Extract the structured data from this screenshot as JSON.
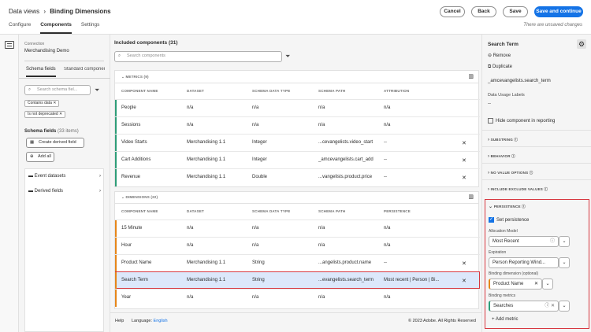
{
  "header": {
    "crumb_root": "Data views",
    "crumb_sep": "›",
    "crumb_current": "Binding Dimensions",
    "tabs": [
      "Configure",
      "Components",
      "Settings"
    ],
    "buttons": {
      "cancel": "Cancel",
      "back": "Back",
      "save": "Save",
      "save_continue": "Save and continue"
    },
    "unsaved": "There are unsaved changes"
  },
  "left": {
    "connection_label": "Connection",
    "connection_value": "Merchandising Demo",
    "tabs": [
      "Schema fields",
      "Standard componen"
    ],
    "search_placeholder": "Search schema fiel...",
    "filters": [
      "Contains data",
      "Is not deprecated"
    ],
    "count_label": "Schema fields",
    "count_value": "(33 items)",
    "create_btn": "Create derived field",
    "add_all": "Add all",
    "folders": [
      "Event datasets",
      "Derived fields"
    ]
  },
  "center": {
    "title": "Included components",
    "title_count": "(31)",
    "search_placeholder": "Search components",
    "metrics_label": "METRICS",
    "metrics_count": "(9)",
    "dimensions_label": "DIMENSIONS",
    "dimensions_count": "(22)",
    "metric_headers": [
      "COMPONENT NAME",
      "DATASET",
      "SCHEMA DATA TYPE",
      "SCHEMA PATH",
      "ATTRIBUTION"
    ],
    "dimension_headers": [
      "COMPONENT NAME",
      "DATASET",
      "SCHEMA DATA TYPE",
      "SCHEMA PATH",
      "PERSISTENCE"
    ],
    "metrics": [
      {
        "name": "People",
        "dataset": "n/a",
        "type": "n/a",
        "path": "n/a",
        "attr": "n/a",
        "x": ""
      },
      {
        "name": "Sessions",
        "dataset": "n/a",
        "type": "n/a",
        "path": "n/a",
        "attr": "n/a",
        "x": ""
      },
      {
        "name": "Video Starts",
        "dataset": "Merchandising 1.1",
        "type": "Integer",
        "path": "...cevangelists.video_start",
        "attr": "--",
        "x": "✕"
      },
      {
        "name": "Cart Additions",
        "dataset": "Merchandising 1.1",
        "type": "Integer",
        "path": "_amcevangelists.cart_add",
        "attr": "--",
        "x": "✕"
      },
      {
        "name": "Revenue",
        "dataset": "Merchandising 1.1",
        "type": "Double",
        "path": "...vangelists.product.price",
        "attr": "--",
        "x": "✕"
      }
    ],
    "dimensions": [
      {
        "name": "15 Minute",
        "dataset": "n/a",
        "type": "n/a",
        "path": "n/a",
        "pers": "n/a",
        "x": ""
      },
      {
        "name": "Hour",
        "dataset": "n/a",
        "type": "n/a",
        "path": "n/a",
        "pers": "n/a",
        "x": ""
      },
      {
        "name": "Product Name",
        "dataset": "Merchandising 1.1",
        "type": "String",
        "path": "...angelists.product.name",
        "pers": "--",
        "x": "✕"
      },
      {
        "name": "Search Term",
        "dataset": "Merchandising 1.1",
        "type": "String",
        "path": "...evangelists.search_term",
        "pers": "Most recent | Person | Bi...",
        "x": "✕"
      },
      {
        "name": "Year",
        "dataset": "n/a",
        "type": "n/a",
        "path": "n/a",
        "pers": "n/a",
        "x": ""
      }
    ],
    "footer_help": "Help",
    "footer_lang_label": "Language:",
    "footer_lang": "English",
    "footer_copy": "© 2023 Adobe. All Rights Reserved"
  },
  "right": {
    "title": "Search Term",
    "remove": "Remove",
    "duplicate": "Duplicate",
    "path": "_amcevangelists.search_term",
    "usage_label": "Data Usage Labels",
    "usage_value": "--",
    "hide_label": "Hide component in reporting",
    "sections": [
      "SUBSTRING",
      "BEHAVIOR",
      "NO VALUE OPTIONS",
      "INCLUDE EXCLUDE VALUES"
    ],
    "persistence": "PERSISTENCE",
    "set_persistence": "Set persistence",
    "alloc_label": "Allocation Model",
    "alloc_value": "Most Recent",
    "exp_label": "Expiration",
    "exp_value": "Person Reporting Wind...",
    "bind_dim_label": "Binding dimension (optional)",
    "bind_dim_value": "Product Name",
    "bind_met_label": "Binding metrics",
    "bind_met_value": "Searches",
    "add_metric": "Add metric"
  }
}
